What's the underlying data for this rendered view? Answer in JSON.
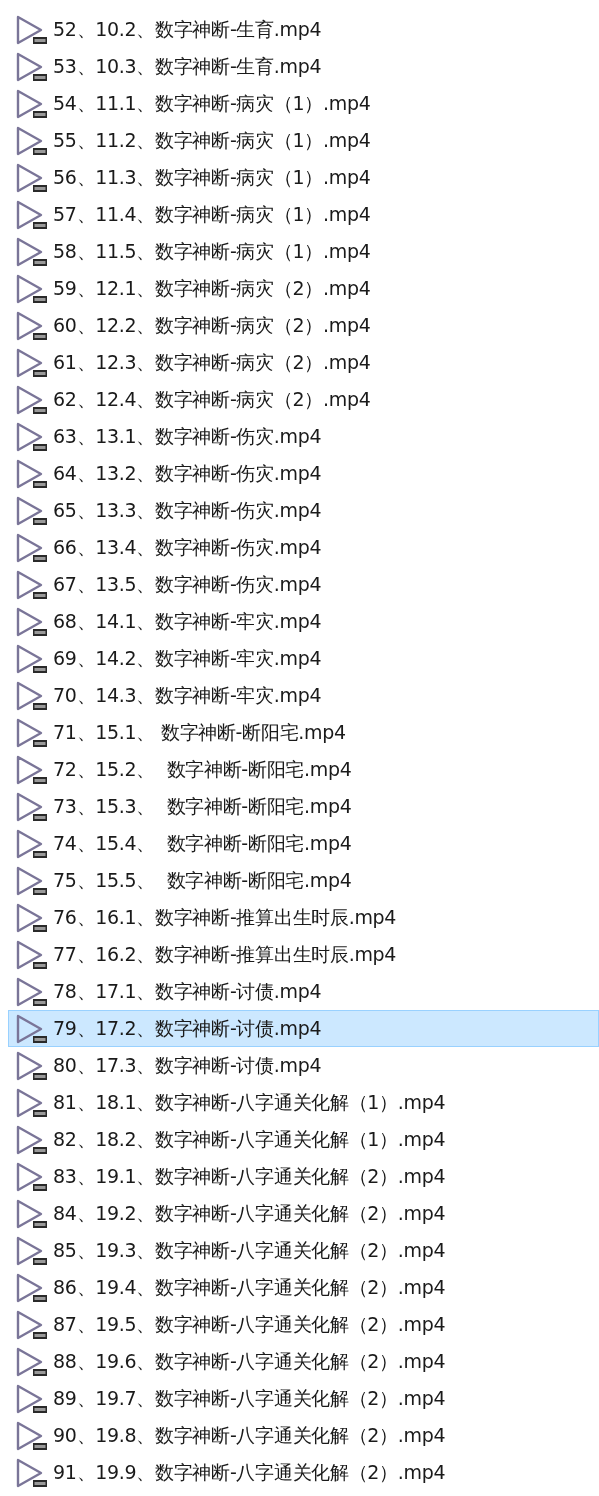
{
  "files": [
    {
      "name": "52、10.2、数字神断-生育.mp4",
      "selected": false
    },
    {
      "name": "53、10.3、数字神断-生育.mp4",
      "selected": false
    },
    {
      "name": "54、11.1、数字神断-病灾（1）.mp4",
      "selected": false
    },
    {
      "name": "55、11.2、数字神断-病灾（1）.mp4",
      "selected": false
    },
    {
      "name": "56、11.3、数字神断-病灾（1）.mp4",
      "selected": false
    },
    {
      "name": "57、11.4、数字神断-病灾（1）.mp4",
      "selected": false
    },
    {
      "name": "58、11.5、数字神断-病灾（1）.mp4",
      "selected": false
    },
    {
      "name": "59、12.1、数字神断-病灾（2）.mp4",
      "selected": false
    },
    {
      "name": "60、12.2、数字神断-病灾（2）.mp4",
      "selected": false
    },
    {
      "name": "61、12.3、数字神断-病灾（2）.mp4",
      "selected": false
    },
    {
      "name": "62、12.4、数字神断-病灾（2）.mp4",
      "selected": false
    },
    {
      "name": "63、13.1、数字神断-伤灾.mp4",
      "selected": false
    },
    {
      "name": "64、13.2、数字神断-伤灾.mp4",
      "selected": false
    },
    {
      "name": "65、13.3、数字神断-伤灾.mp4",
      "selected": false
    },
    {
      "name": "66、13.4、数字神断-伤灾.mp4",
      "selected": false
    },
    {
      "name": "67、13.5、数字神断-伤灾.mp4",
      "selected": false
    },
    {
      "name": "68、14.1、数字神断-牢灾.mp4",
      "selected": false
    },
    {
      "name": "69、14.2、数字神断-牢灾.mp4",
      "selected": false
    },
    {
      "name": "70、14.3、数字神断-牢灾.mp4",
      "selected": false
    },
    {
      "name": "71、15.1、 数字神断-断阳宅.mp4",
      "selected": false
    },
    {
      "name": "72、15.2、  数字神断-断阳宅.mp4",
      "selected": false
    },
    {
      "name": "73、15.3、  数字神断-断阳宅.mp4",
      "selected": false
    },
    {
      "name": "74、15.4、  数字神断-断阳宅.mp4",
      "selected": false
    },
    {
      "name": "75、15.5、  数字神断-断阳宅.mp4",
      "selected": false
    },
    {
      "name": "76、16.1、数字神断-推算出生时辰.mp4",
      "selected": false
    },
    {
      "name": "77、16.2、数字神断-推算出生时辰.mp4",
      "selected": false
    },
    {
      "name": "78、17.1、数字神断-讨债.mp4",
      "selected": false
    },
    {
      "name": "79、17.2、数字神断-讨债.mp4",
      "selected": true
    },
    {
      "name": "80、17.3、数字神断-讨债.mp4",
      "selected": false
    },
    {
      "name": "81、18.1、数字神断-八字通关化解（1）.mp4",
      "selected": false
    },
    {
      "name": "82、18.2、数字神断-八字通关化解（1）.mp4",
      "selected": false
    },
    {
      "name": "83、19.1、数字神断-八字通关化解（2）.mp4",
      "selected": false
    },
    {
      "name": "84、19.2、数字神断-八字通关化解（2）.mp4",
      "selected": false
    },
    {
      "name": "85、19.3、数字神断-八字通关化解（2）.mp4",
      "selected": false
    },
    {
      "name": "86、19.4、数字神断-八字通关化解（2）.mp4",
      "selected": false
    },
    {
      "name": "87、19.5、数字神断-八字通关化解（2）.mp4",
      "selected": false
    },
    {
      "name": "88、19.6、数字神断-八字通关化解（2）.mp4",
      "selected": false
    },
    {
      "name": "89、19.7、数字神断-八字通关化解（2）.mp4",
      "selected": false
    },
    {
      "name": "90、19.8、数字神断-八字通关化解（2）.mp4",
      "selected": false
    },
    {
      "name": "91、19.9、数字神断-八字通关化解（2）.mp4",
      "selected": false
    }
  ]
}
